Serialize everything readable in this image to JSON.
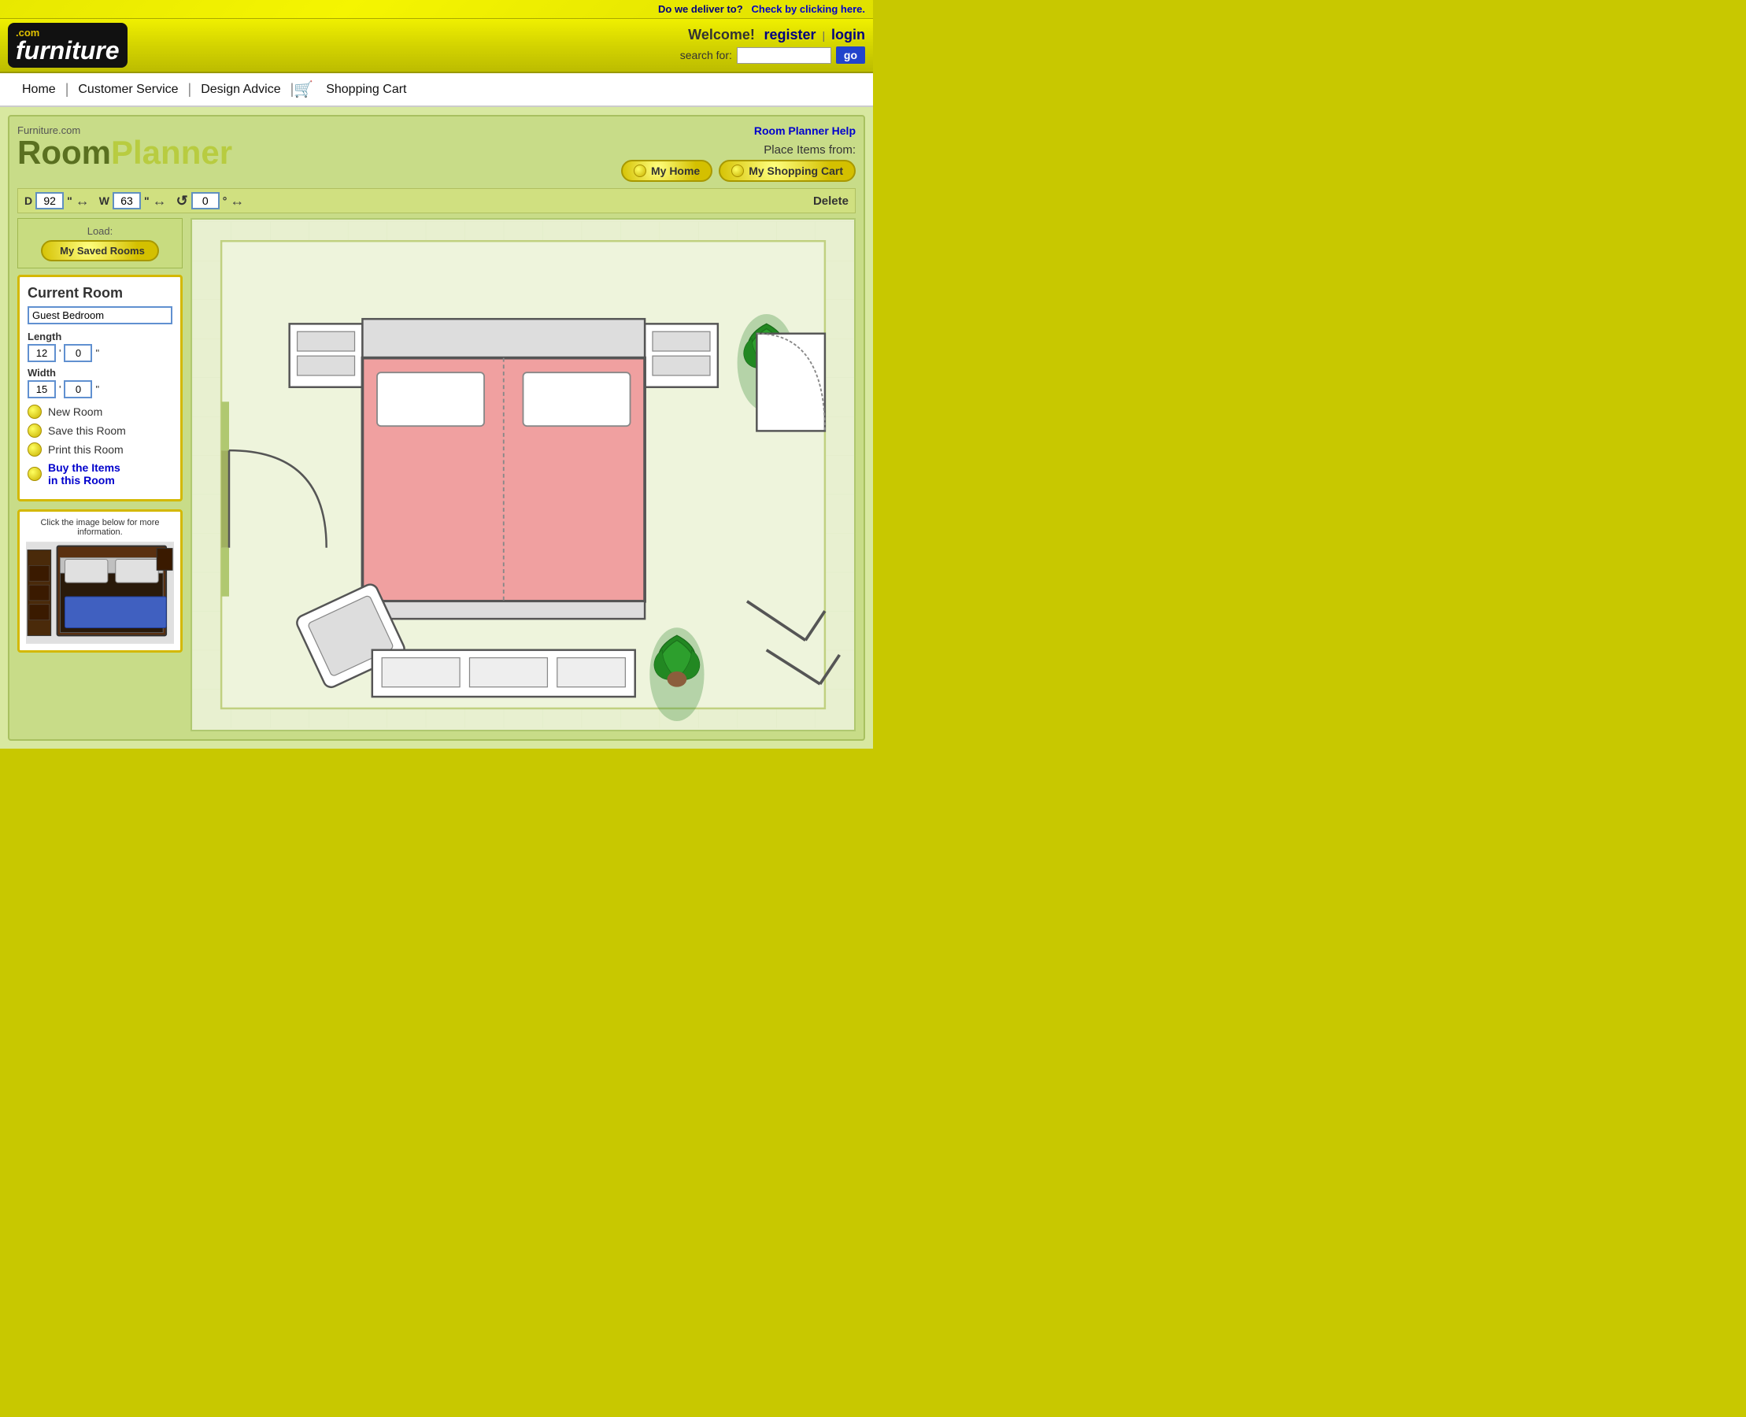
{
  "topbar": {
    "deliver_text": "Do we deliver to?",
    "deliver_link": "Check by clicking here."
  },
  "header": {
    "logo_com": ".com",
    "logo_name": "furniture",
    "welcome": "Welcome!",
    "register": "register",
    "pipe": "|",
    "login": "login",
    "search_label": "search for:",
    "search_placeholder": "",
    "go_label": "go"
  },
  "nav": {
    "home": "Home",
    "customer_service": "Customer Service",
    "design_advice": "Design Advice",
    "shopping_cart": "Shopping Cart"
  },
  "planner": {
    "help_link": "Room Planner Help",
    "logo_fc": "Furniture.com",
    "logo_rp": "Room Planner",
    "place_items_label": "Place Items from:",
    "my_home": "My Home",
    "my_shopping_cart": "My Shopping Cart",
    "controls": {
      "d_label": "D",
      "d_value": "92",
      "d_unit": "\"",
      "w_label": "W",
      "w_value": "63",
      "w_unit": "\"",
      "r_value": "0",
      "r_unit": "°",
      "delete_label": "Delete"
    },
    "load_label": "Load:",
    "load_btn": "My Saved Rooms",
    "current_room": {
      "title": "Current Room",
      "name": "Guest Bedroom",
      "length_label": "Length",
      "length_ft": "12",
      "length_in": "0",
      "length_unit": "\"",
      "width_label": "Width",
      "width_ft": "15",
      "width_in": "0",
      "width_unit": "\""
    },
    "actions": {
      "new_room": "New Room",
      "save_room": "Save this Room",
      "print_room": "Print this Room",
      "buy_items": "Buy the Items\nin this Room"
    },
    "info_box": {
      "label": "Click the image below for more information."
    }
  }
}
